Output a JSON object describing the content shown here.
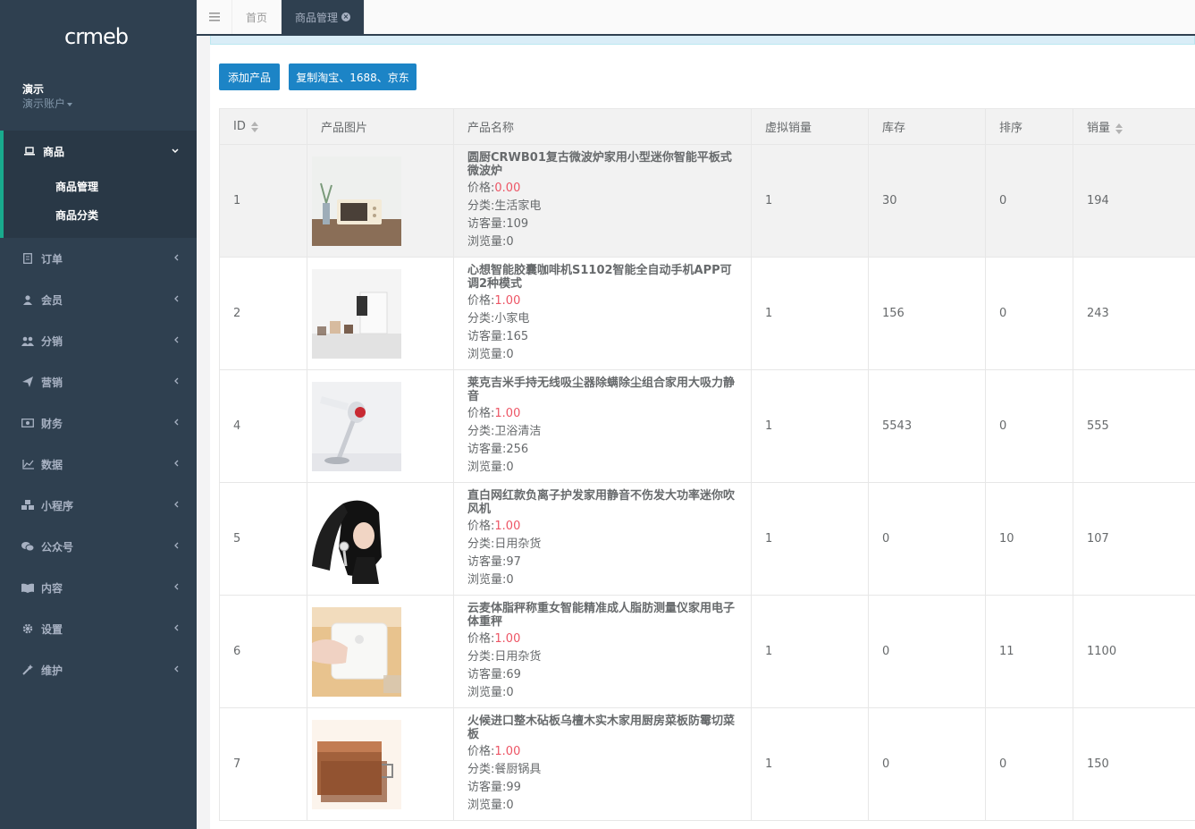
{
  "logo": {
    "text": "crmeb"
  },
  "profile": {
    "name": "演示",
    "role": "演示账户"
  },
  "sidebar": {
    "active": {
      "label": "商品",
      "subitems": [
        "商品管理",
        "商品分类"
      ]
    },
    "items": [
      {
        "label": "订单",
        "icon": "order-icon"
      },
      {
        "label": "会员",
        "icon": "user-icon"
      },
      {
        "label": "分销",
        "icon": "users-icon"
      },
      {
        "label": "营销",
        "icon": "send-icon"
      },
      {
        "label": "财务",
        "icon": "money-icon"
      },
      {
        "label": "数据",
        "icon": "chart-icon"
      },
      {
        "label": "小程序",
        "icon": "cubes-icon"
      },
      {
        "label": "公众号",
        "icon": "wechat-icon"
      },
      {
        "label": "内容",
        "icon": "book-icon"
      },
      {
        "label": "设置",
        "icon": "gear-icon"
      },
      {
        "label": "维护",
        "icon": "wand-icon"
      }
    ]
  },
  "tabs": [
    {
      "label": "首页",
      "active": false
    },
    {
      "label": "商品管理",
      "active": true
    }
  ],
  "toolbar": {
    "add_label": "添加产品",
    "copy_label": "复制淘宝、1688、京东"
  },
  "table": {
    "headers": [
      "ID",
      "产品图片",
      "产品名称",
      "虚拟销量",
      "库存",
      "排序",
      "销量"
    ],
    "labels": {
      "price": "价格:",
      "category": "分类:",
      "visitors": "访客量:",
      "views": "浏览量:"
    },
    "rows": [
      {
        "id": "1",
        "name": "圆厨CRWB01复古微波炉家用小型迷你智能平板式微波炉",
        "price": "0.00",
        "category": "生活家电",
        "visitors": "109",
        "views": "0",
        "virtual_sales": "1",
        "stock": "30",
        "sort": "0",
        "sales": "194",
        "thumb": "microwave"
      },
      {
        "id": "2",
        "name": "心想智能胶囊咖啡机S1102智能全自动手机APP可调2种模式",
        "price": "1.00",
        "category": "小家电",
        "visitors": "165",
        "views": "0",
        "virtual_sales": "1",
        "stock": "156",
        "sort": "0",
        "sales": "243",
        "thumb": "coffee-machine"
      },
      {
        "id": "4",
        "name": "莱克吉米手持无线吸尘器除螨除尘组合家用大吸力静音",
        "price": "1.00",
        "category": "卫浴清洁",
        "visitors": "256",
        "views": "0",
        "virtual_sales": "1",
        "stock": "5543",
        "sort": "0",
        "sales": "555",
        "thumb": "vacuum"
      },
      {
        "id": "5",
        "name": "直白网红款负离子护发家用静音不伤发大功率迷你吹风机",
        "price": "1.00",
        "category": "日用杂货",
        "visitors": "97",
        "views": "0",
        "virtual_sales": "1",
        "stock": "0",
        "sort": "10",
        "sales": "107",
        "thumb": "hair-dryer"
      },
      {
        "id": "6",
        "name": "云麦体脂秤称重女智能精准成人脂肪测量仪家用电子体重秤",
        "price": "1.00",
        "category": "日用杂货",
        "visitors": "69",
        "views": "0",
        "virtual_sales": "1",
        "stock": "0",
        "sort": "11",
        "sales": "1100",
        "thumb": "scale"
      },
      {
        "id": "7",
        "name": "火候进口整木砧板乌檀木实木家用厨房菜板防霉切菜板",
        "price": "1.00",
        "category": "餐厨锅具",
        "visitors": "99",
        "views": "0",
        "virtual_sales": "1",
        "stock": "0",
        "sort": "0",
        "sales": "150",
        "thumb": "cutting-board"
      }
    ]
  }
}
